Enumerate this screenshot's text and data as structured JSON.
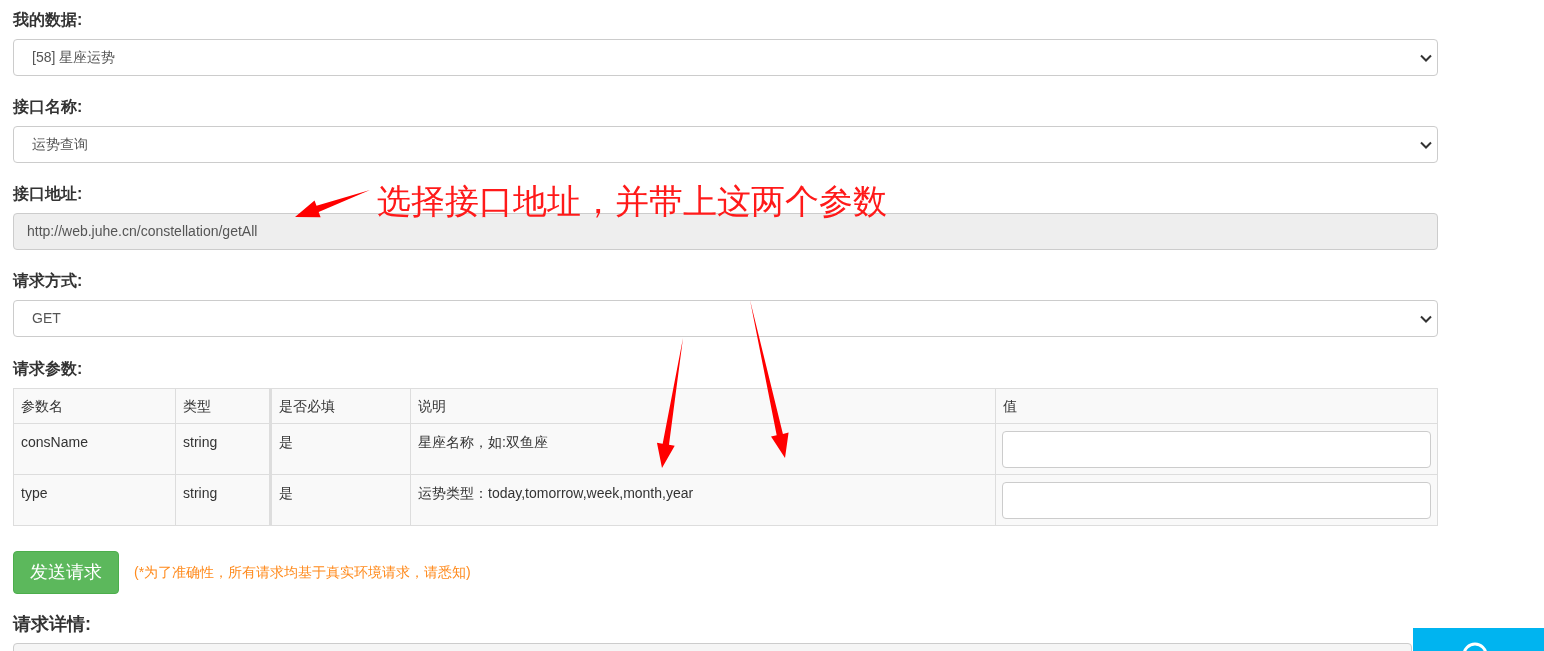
{
  "fields": [
    {
      "label": "我的数据:",
      "kind": "select",
      "value": "[58] 星座运势"
    },
    {
      "label": "接口名称:",
      "kind": "select",
      "value": "运势查询"
    },
    {
      "label": "接口地址:",
      "kind": "readonly",
      "value": "http://web.juhe.cn/constellation/getAll"
    },
    {
      "label": "请求方式:",
      "kind": "select",
      "value": "GET"
    }
  ],
  "params": {
    "label": "请求参数:",
    "columns": [
      "参数名",
      "类型",
      "是否必填",
      "说明",
      "值"
    ],
    "rows": [
      {
        "name": "consName",
        "type": "string",
        "required": "是",
        "description": "星座名称，如:双鱼座"
      },
      {
        "name": "type",
        "type": "string",
        "required": "是",
        "description": "运势类型：today,tomorrow,week,month,year"
      }
    ]
  },
  "send_button": "发送请求",
  "notice": "(*为了准确性，所有请求均基于真实环境请求，请悉知)",
  "detail_label": "请求详情:",
  "annotation": "选择接口地址，并带上这两个参数"
}
